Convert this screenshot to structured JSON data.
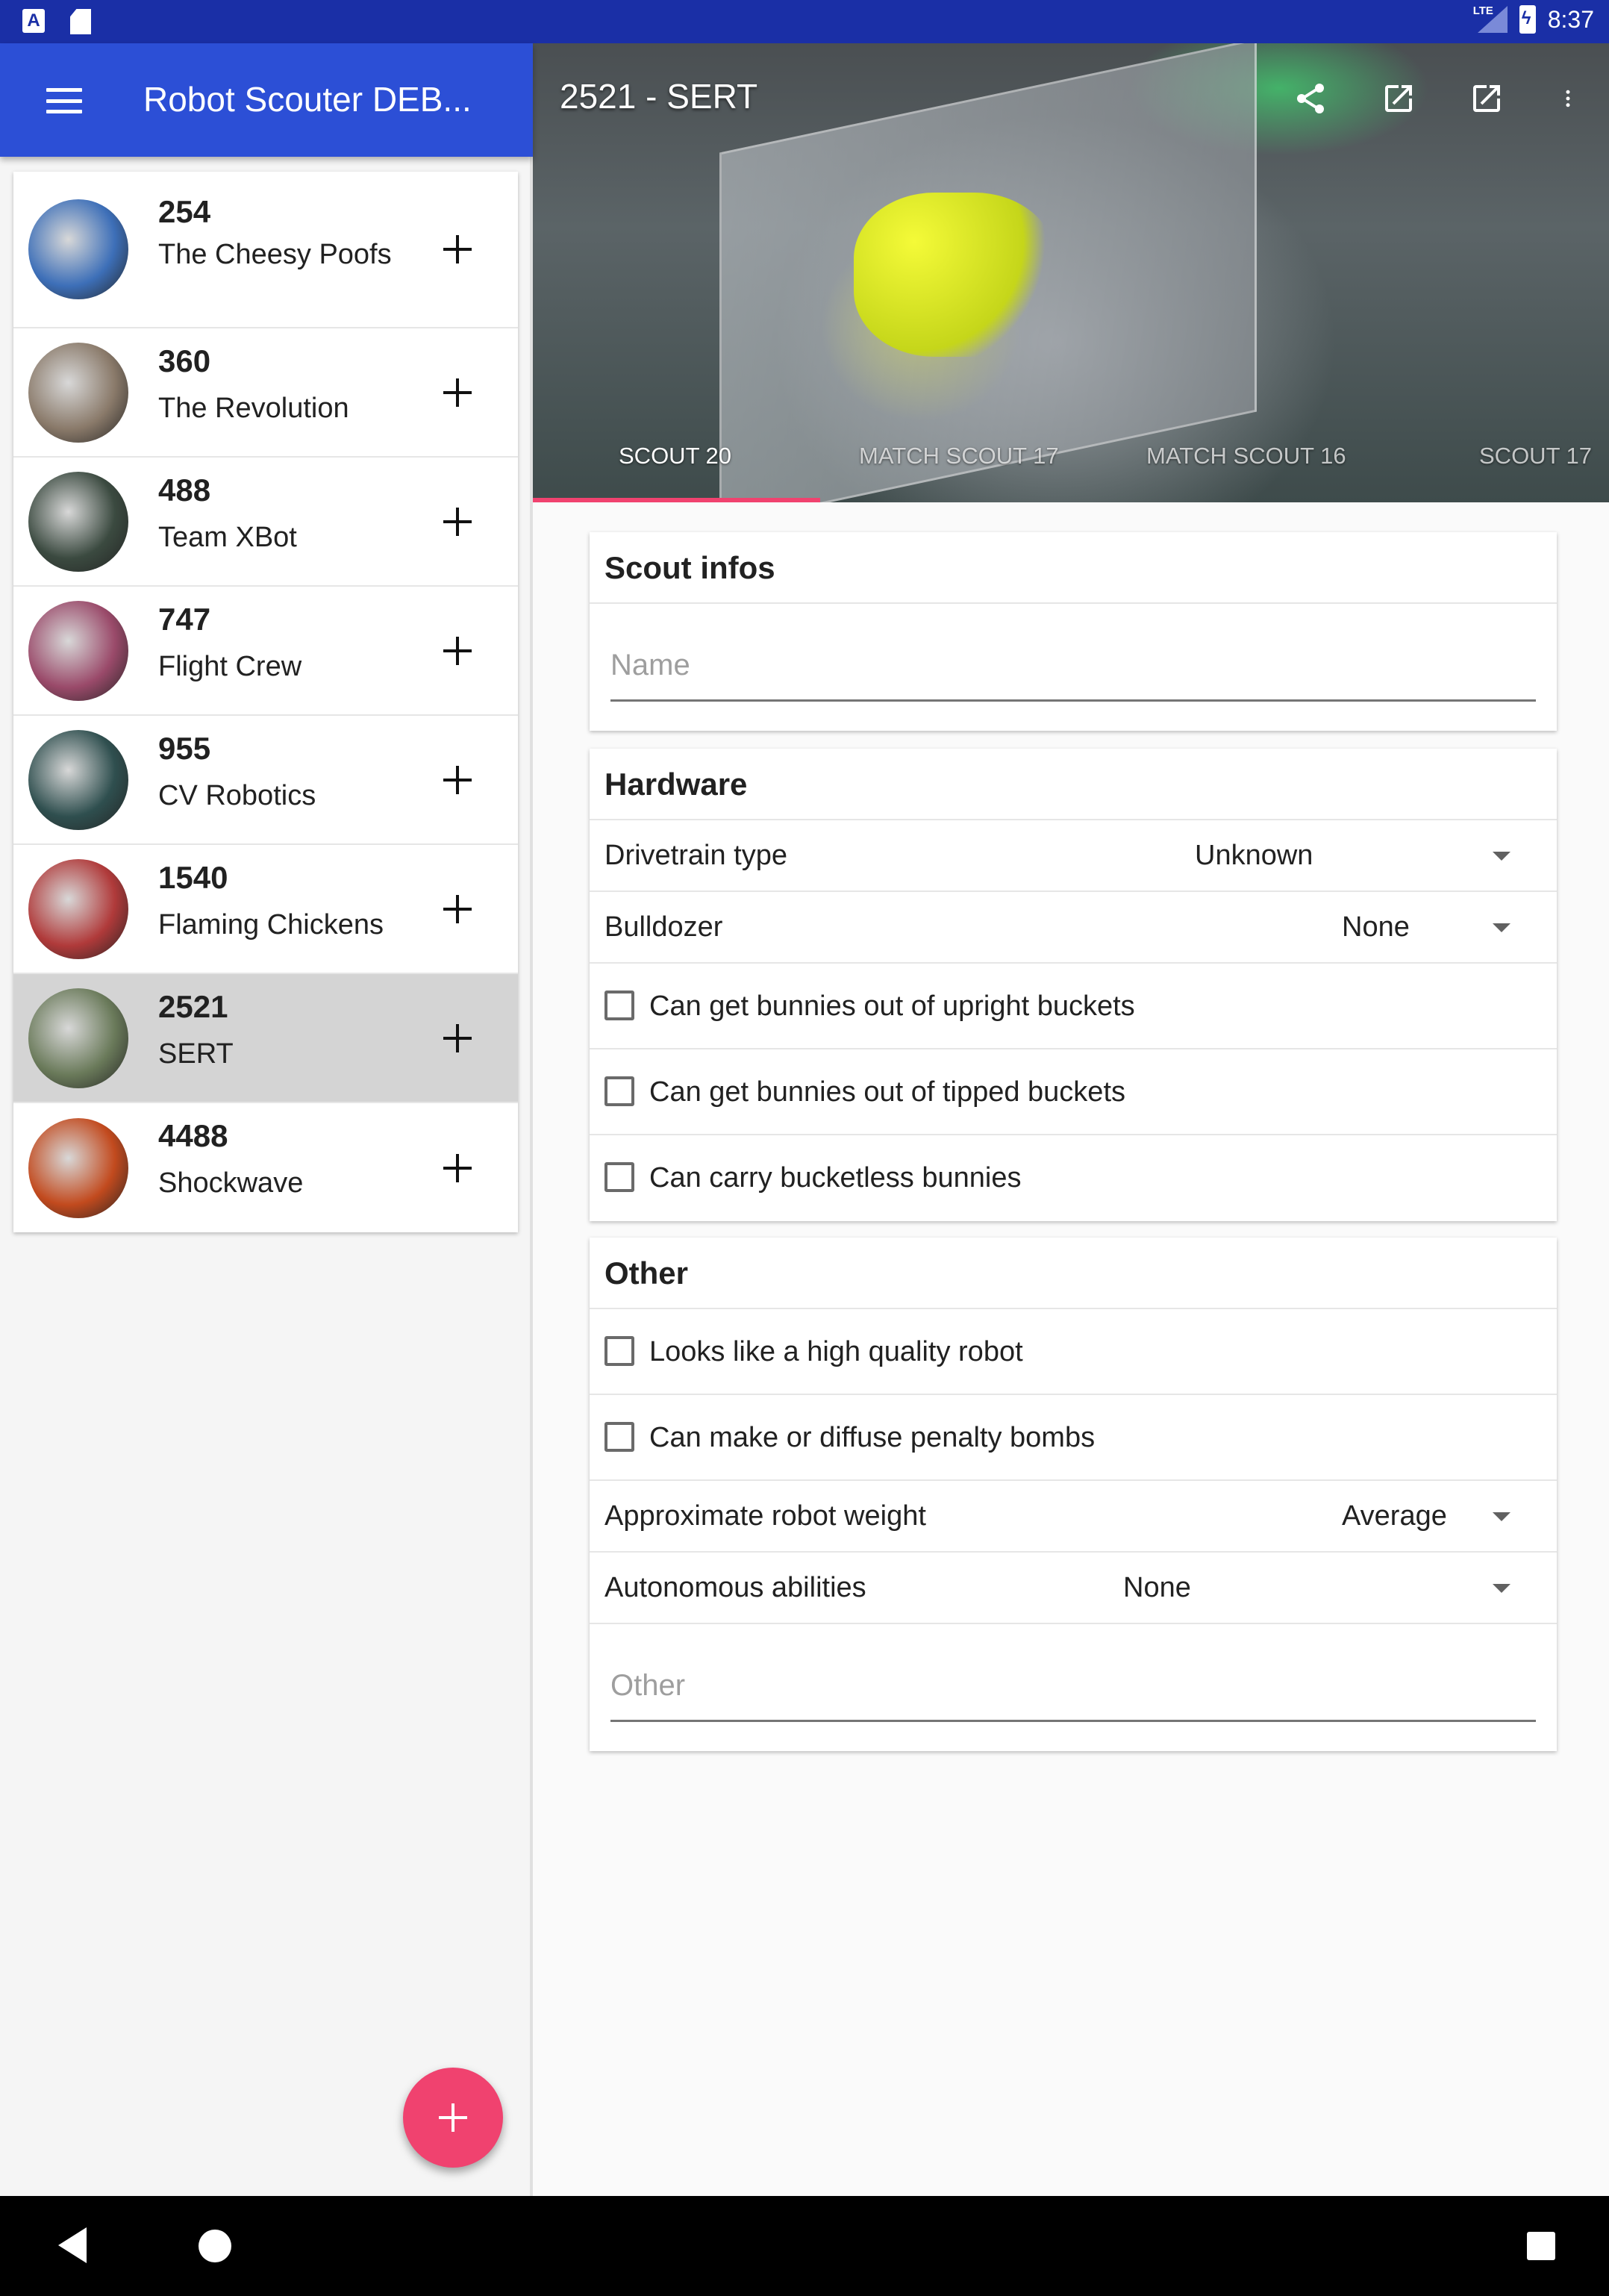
{
  "status_bar": {
    "lte": "LTE",
    "time": "8:37"
  },
  "app_bar": {
    "title": "Robot Scouter DEB..."
  },
  "teams": [
    {
      "number": "254",
      "name": "The Cheesy Poofs",
      "selected": false,
      "avatar_color": "#3d6fb8"
    },
    {
      "number": "360",
      "name": "The Revolution",
      "selected": false,
      "avatar_color": "#8a7a6a"
    },
    {
      "number": "488",
      "name": "Team XBot",
      "selected": false,
      "avatar_color": "#3b4a40"
    },
    {
      "number": "747",
      "name": "Flight Crew",
      "selected": false,
      "avatar_color": "#9a4a6a"
    },
    {
      "number": "955",
      "name": "CV Robotics",
      "selected": false,
      "avatar_color": "#2f4f4f"
    },
    {
      "number": "1540",
      "name": "Flaming Chickens",
      "selected": false,
      "avatar_color": "#b03a3a"
    },
    {
      "number": "2521",
      "name": "SERT",
      "selected": true,
      "avatar_color": "#6a7a5a"
    },
    {
      "number": "4488",
      "name": "Shockwave",
      "selected": false,
      "avatar_color": "#c24a1e"
    }
  ],
  "detail": {
    "title": "2521 - SERT",
    "actions": [
      "share-icon",
      "open-in-new-icon",
      "open-in-new-icon",
      "more-vert-icon"
    ],
    "tabs": [
      "SCOUT 20",
      "MATCH SCOUT 17",
      "MATCH SCOUT 16",
      "SCOUT 17"
    ]
  },
  "scout_infos": {
    "title": "Scout infos",
    "name_placeholder": "Name"
  },
  "hardware": {
    "title": "Hardware",
    "drivetrain_label": "Drivetrain type",
    "drivetrain_value": "Unknown",
    "bulldozer_label": "Bulldozer",
    "bulldozer_value": "None",
    "check_upright": "Can get bunnies out of upright buckets",
    "check_tipped": "Can get bunnies out of tipped buckets",
    "check_carry": "Can carry bucketless bunnies"
  },
  "other": {
    "title": "Other",
    "check_quality": "Looks like a high quality robot",
    "check_bombs": "Can make or diffuse penalty bombs",
    "weight_label": "Approximate robot weight",
    "weight_value": "Average",
    "auto_label": "Autonomous abilities",
    "auto_value": "None",
    "other_placeholder": "Other"
  },
  "colors": {
    "primary": "#2c4fd6",
    "status_bar": "#1a2fa6",
    "accent": "#f0426f"
  }
}
